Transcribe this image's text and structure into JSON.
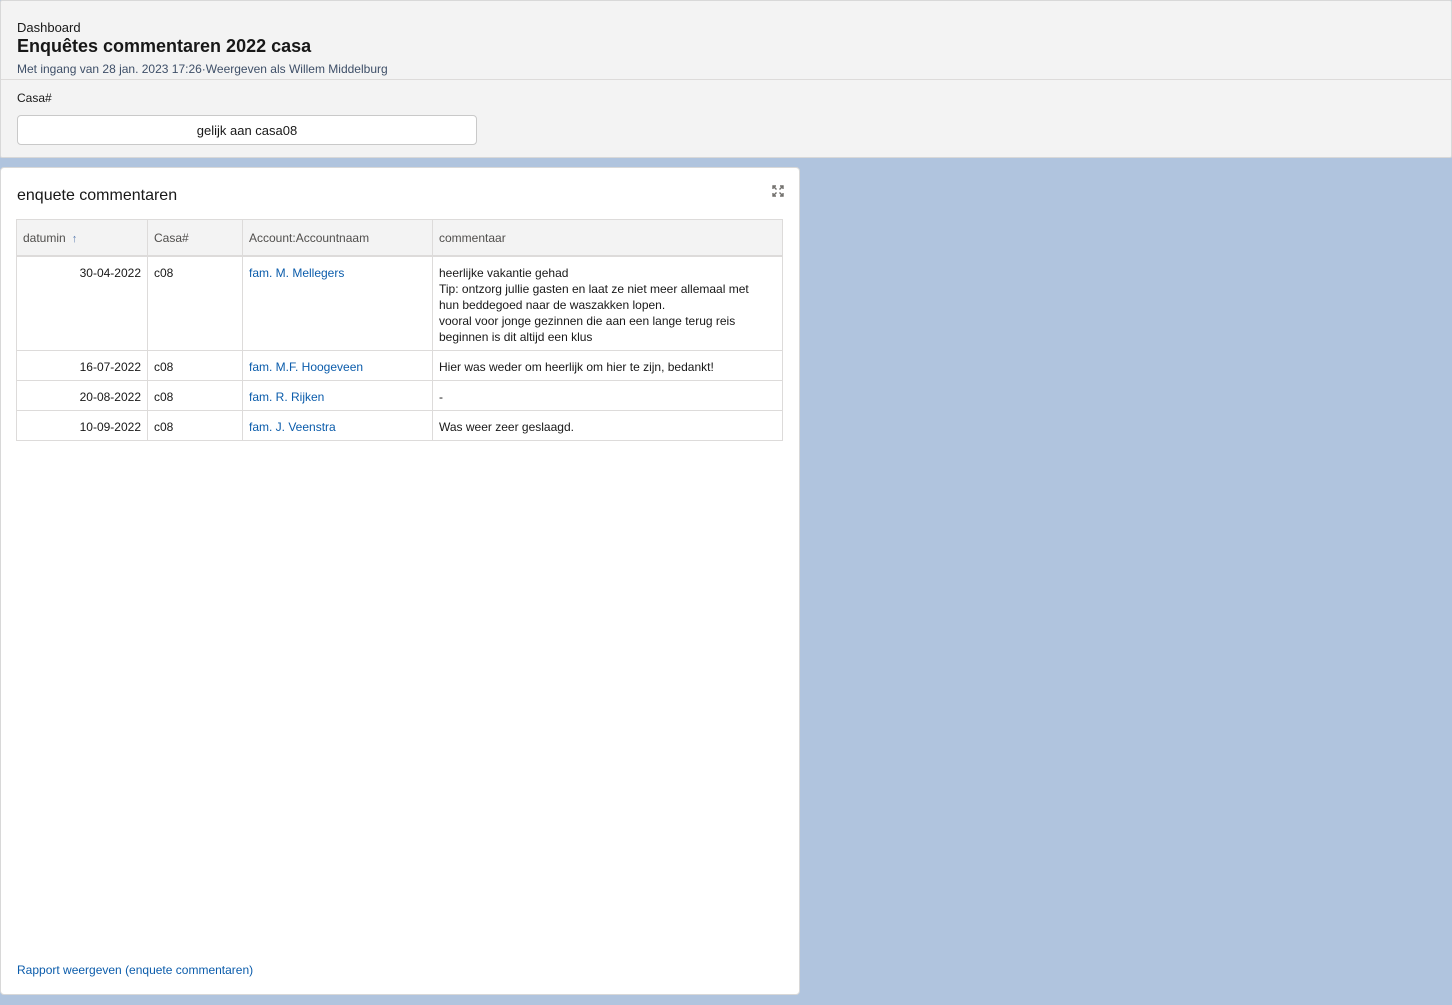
{
  "header": {
    "eyebrow": "Dashboard",
    "title": "Enquêtes commentaren 2022 casa",
    "meta": "Met ingang van 28 jan. 2023 17:26·Weergeven als Willem Middelburg"
  },
  "filter": {
    "label": "Casa#",
    "value": "gelijk aan casa08"
  },
  "report": {
    "title": "enquete commentaren",
    "columns": [
      "datumin",
      "Casa#",
      "Account:Accountnaam",
      "commentaar"
    ],
    "rows": [
      {
        "date": "30-04-2022",
        "casa": "c08",
        "account": "fam. M. Mellegers",
        "comment": [
          "heerlijke vakantie gehad",
          "Tip: ontzorg jullie gasten en laat ze niet meer allemaal met",
          "hun beddegoed naar de waszakken lopen.",
          "vooral voor jonge gezinnen die aan een lange terug reis",
          "beginnen is dit altijd een klus"
        ]
      },
      {
        "date": "16-07-2022",
        "casa": "c08",
        "account": "fam. M.F. Hoogeveen",
        "comment": [
          "Hier was weder om heerlijk om hier te zijn, bedankt!"
        ]
      },
      {
        "date": "20-08-2022",
        "casa": "c08",
        "account": "fam. R. Rijken",
        "comment": [
          "-"
        ]
      },
      {
        "date": "10-09-2022",
        "casa": "c08",
        "account": "fam. J. Veenstra",
        "comment": [
          "Was weer zeer geslaagd."
        ]
      }
    ],
    "footer_link": "Rapport weergeven (enquete commentaren)"
  },
  "icons": {
    "sort": "arrow-up-icon",
    "expand": "expand-icon"
  },
  "colors": {
    "background": "#b0c4de",
    "link": "#0b5cab"
  }
}
